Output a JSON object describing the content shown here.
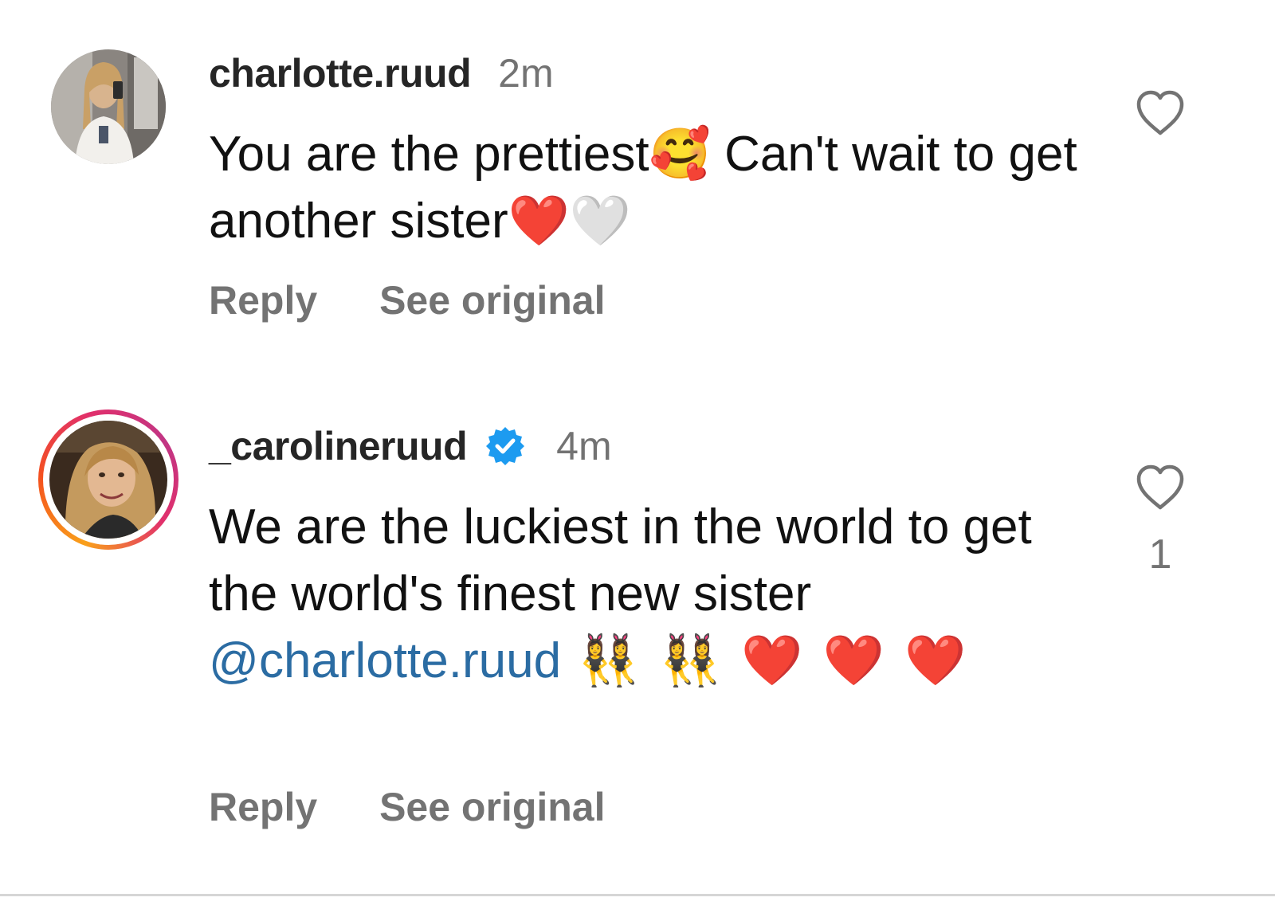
{
  "comments": [
    {
      "username": "charlotte.ruud",
      "verified": false,
      "timestamp": "2m",
      "text": "You are the prettiest🥰 Can't wait to get another sister❤️🤍",
      "reply_label": "Reply",
      "see_original_label": "See original",
      "like_icon": "heart-outline-icon"
    },
    {
      "username": "_carolineruud",
      "verified": true,
      "has_story_ring": true,
      "timestamp": "4m",
      "text_before_mention": "We are the luckiest in the world to get the world's finest new sister ",
      "mention": "@charlotte.ruud",
      "text_after_mention": " 👯‍♀️ 👯‍♀️ ❤️ ❤️ ❤️",
      "like_count": "1",
      "reply_label": "Reply",
      "see_original_label": "See original",
      "like_icon": "heart-outline-icon"
    }
  ],
  "colors": {
    "username": "#262626",
    "secondary_text": "#737373",
    "mention": "#2b6ca3",
    "verified_badge": "#1d9bf0"
  }
}
